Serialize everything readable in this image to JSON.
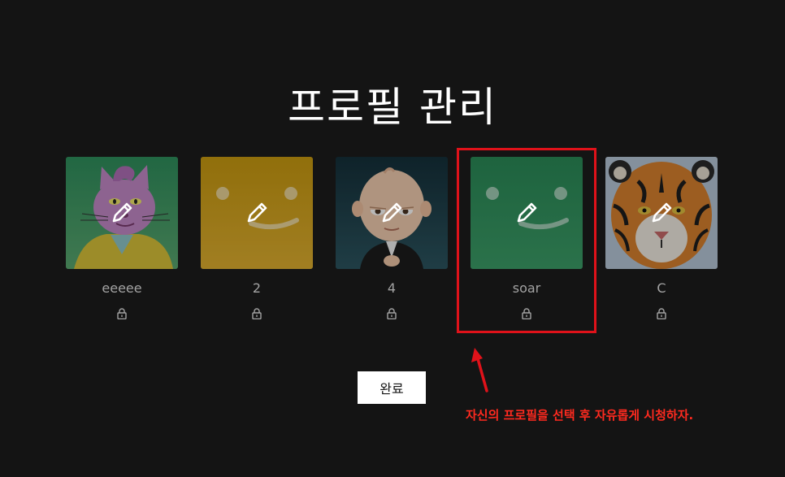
{
  "page": {
    "title": "프로필 관리"
  },
  "profiles": [
    {
      "name": "eeeee",
      "avatar": "cat-cartoon-avatar",
      "bg": "#2a8a57"
    },
    {
      "name": "2",
      "avatar": "smiley-yellow-avatar",
      "bg": "#d4a017"
    },
    {
      "name": "4",
      "avatar": "boss-baby-avatar",
      "bg": "#1f3a44"
    },
    {
      "name": "soar",
      "avatar": "smiley-green-avatar",
      "bg": "#2a8a57"
    },
    {
      "name": "C",
      "avatar": "tiger-avatar",
      "bg": "#c8702a"
    }
  ],
  "actions": {
    "done_label": "완료"
  },
  "annotation": {
    "text": "자신의 프로필을 선택 후 자유롭게 시청하자.",
    "color": "#ff2a1f"
  },
  "icons": {
    "edit": "pencil-icon",
    "lock": "lock-icon"
  }
}
